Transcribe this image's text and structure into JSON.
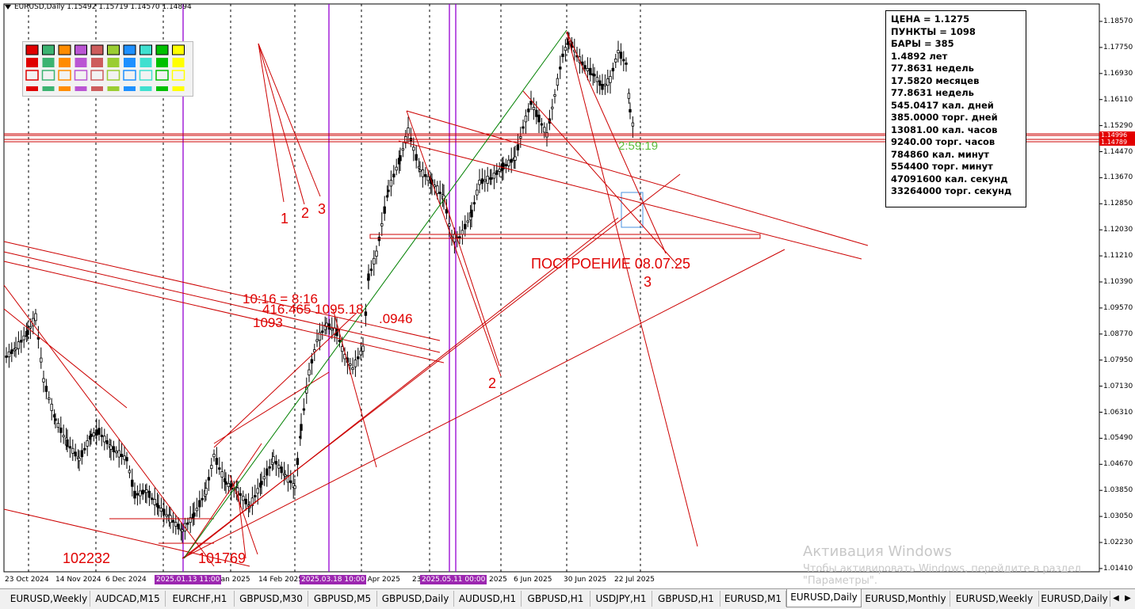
{
  "header": {
    "symbol_line": "EURUSD,Daily  1.15492 1.15719 1.14570 1.14894"
  },
  "info_panel": {
    "lines": [
      "ЦЕНА = 1.1275",
      "ПУНКТЫ = 1098",
      "БАРЫ = 385",
      "1.4892 лет",
      "77.8631 недель",
      "17.5820 месяцев",
      "77.8631 недель",
      "545.0417 кал. дней",
      "385.0000 торг. дней",
      "13081.00 кал. часов",
      "9240.00 торг. часов",
      "784860 кал. минут",
      "554400 торг. минут",
      "47091600 кал. секунд",
      "33264000 торг. секунд"
    ]
  },
  "price_axis": {
    "labels": [
      "1.18570",
      "1.17750",
      "1.16930",
      "1.16110",
      "1.15290",
      "1.14470",
      "1.13670",
      "1.12850",
      "1.12030",
      "1.11210",
      "1.10390",
      "1.09570",
      "1.08770",
      "1.07950",
      "1.07130",
      "1.06310",
      "1.05490",
      "1.04670",
      "1.03850",
      "1.03050",
      "1.02230",
      "1.01410"
    ],
    "bid_tag": "1.14996",
    "ask_tag": "1.14789"
  },
  "time_axis": {
    "labels": [
      "23 Oct 2024",
      "14 Nov 2024",
      "6 Dec 2024",
      "Jan 2025",
      "14 Feb 2025",
      "1 Apr 2025",
      "23",
      "2025",
      "6 Jun 2025",
      "30 Jun 2025",
      "22 Jul 2025"
    ],
    "highlighted": [
      "2025.01.13 11:00",
      "2025.03.18 10:00",
      "2025.05.11 00:00"
    ]
  },
  "annotations": {
    "countdown": "2:59:19",
    "build_label": "ПОСТРОЕНИЕ 08.07.25",
    "wave1": "1",
    "wave2": "2",
    "wave3": "3",
    "wave2b": "2",
    "wave3b": "3",
    "ratio": "10:16 = 8:16",
    "fib_mid": "416.465 1095.18",
    "lvl_1093": "1093",
    "lvl_0946": ".0946",
    "low_left": "102232",
    "low_right": "101769"
  },
  "palette_colors": [
    "#e00000",
    "#3cb371",
    "#ff8c00",
    "#ba55d3",
    "#cd5c5c",
    "#9acd32",
    "#1e90ff",
    "#00c000",
    "#ffff00",
    "#40e0d0"
  ],
  "colors": {
    "candle": "#000000",
    "trendline": "#cc0000",
    "vline": "#9400d3",
    "green_line": "#008000",
    "blue_box": "#4a90e2"
  },
  "watermark": {
    "title": "Активация Windows",
    "subtitle": "Чтобы активировать Windows, перейдите в раздел \"Параметры\"."
  },
  "tabs": [
    {
      "label": "EURUSD,Weekly",
      "active": false
    },
    {
      "label": "AUDCAD,M15",
      "active": false
    },
    {
      "label": "EURCHF,H1",
      "active": false
    },
    {
      "label": "GBPUSD,M30",
      "active": false
    },
    {
      "label": "GBPUSD,M5",
      "active": false
    },
    {
      "label": "GBPUSD,Daily",
      "active": false
    },
    {
      "label": "AUDUSD,H1",
      "active": false
    },
    {
      "label": "GBPUSD,H1",
      "active": false
    },
    {
      "label": "USDJPY,H1",
      "active": false
    },
    {
      "label": "GBPUSD,H1",
      "active": false
    },
    {
      "label": "EURUSD,M1",
      "active": false
    },
    {
      "label": "EURUSD,Daily",
      "active": true
    },
    {
      "label": "EURUSD,Monthly",
      "active": false
    },
    {
      "label": "EURUSD,Weekly",
      "active": false
    },
    {
      "label": "EURUSD,Daily",
      "active": false
    }
  ]
}
